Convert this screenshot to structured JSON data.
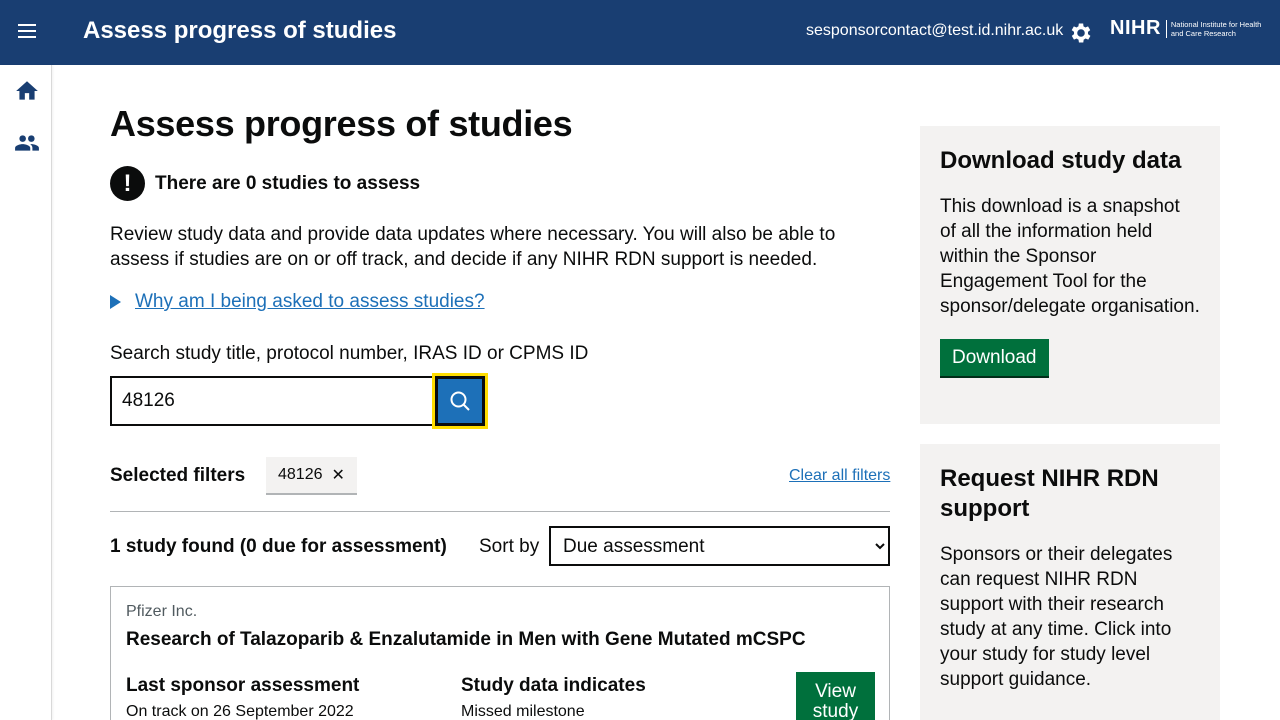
{
  "header": {
    "title": "Assess progress of studies",
    "user_email": "sesponsorcontact@test.id.nihr.ac.uk",
    "logo_main": "NIHR",
    "logo_sub": "National Institute for Health and Care Research"
  },
  "sidenav": {
    "items": [
      "home-icon",
      "users-icon"
    ]
  },
  "page": {
    "title": "Assess progress of studies",
    "warning_text": "There are 0 studies to assess",
    "intro": "Review study data and provide data updates where necessary. You will also be able to assess if studies are on or off track, and decide if any NIHR RDN support is needed.",
    "details_summary": "Why am I being asked to assess studies?"
  },
  "search": {
    "label": "Search study title, protocol number, IRAS ID or CPMS ID",
    "value": "48126",
    "button": "search-icon"
  },
  "filters": {
    "label": "Selected filters",
    "chip": "48126",
    "clear_label": "Clear all filters"
  },
  "results": {
    "count_text": "1 study found (0 due for assessment)",
    "sort_label": "Sort by",
    "sort_value": "Due assessment"
  },
  "study_card": {
    "org": "Pfizer Inc.",
    "title": "Research of Talazoparib & Enzalutamide in Men with Gene Mutated mCSPC",
    "last_assessment_label": "Last sponsor assessment",
    "last_assessment_value": "On track on 26 September 2022",
    "data_indicates_label": "Study data indicates",
    "data_indicates_value": "Missed milestone",
    "view_button": "View study"
  },
  "sidebar": {
    "download_title": "Download study data",
    "download_text": "This download is a snapshot of all the information held within the Sponsor Engagement Tool for the sponsor/delegate organisation.",
    "download_button": "Download",
    "support_title": "Request NIHR RDN support",
    "support_text": "Sponsors or their delegates can request NIHR RDN support with their research study at any time. Click into your study for study level support guidance."
  },
  "colors": {
    "header_bg": "#193e72",
    "link": "#1d70b8",
    "button_green": "#00703c",
    "focus_yellow": "#ffdd00",
    "panel_bg": "#f3f2f1"
  }
}
